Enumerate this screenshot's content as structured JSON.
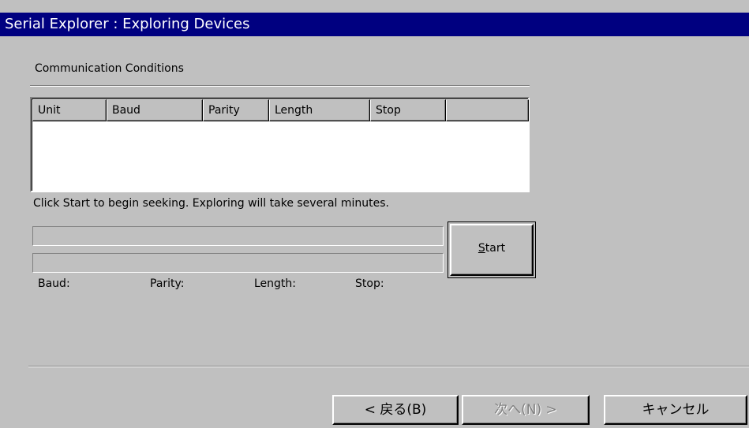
{
  "window": {
    "title": "Serial Explorer : Exploring Devices"
  },
  "group": {
    "label": "Communication Conditions"
  },
  "table": {
    "columns": [
      "Unit",
      "Baud",
      "Parity",
      "Length",
      "Stop",
      ""
    ],
    "rows": []
  },
  "instruction": "Click Start to begin seeking. Exploring will take several minutes.",
  "status": {
    "baud_label": "Baud:",
    "parity_label": "Parity:",
    "length_label": "Length:",
    "stop_label": "Stop:"
  },
  "start_button": {
    "mnemonic": "S",
    "rest": "tart"
  },
  "nav": {
    "back_label": "< 戻る(B)",
    "next_label": "次へ(N) >",
    "cancel_label": "キャンセル"
  }
}
